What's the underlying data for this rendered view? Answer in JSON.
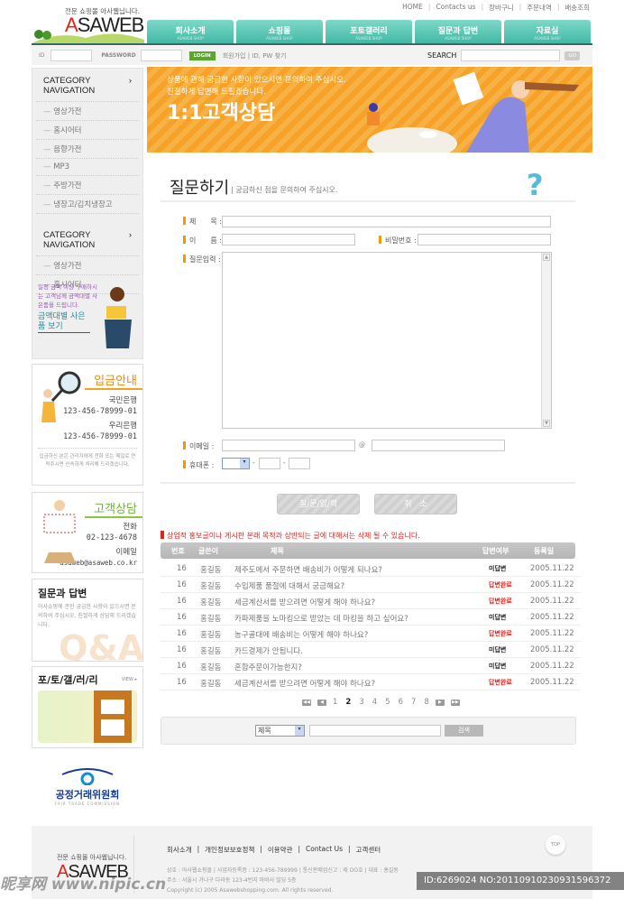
{
  "header": {
    "tagline": "전문 쇼핑몰 아사웹닙니다.",
    "logo_a": "A",
    "logo_rest": "SAWEB",
    "top_links": [
      "HOME",
      "Contacts us",
      "장바구니",
      "주문내역",
      "배송조회"
    ],
    "tabs": [
      {
        "label": "회사소개",
        "sub": "ASAWEB SHOP"
      },
      {
        "label": "쇼핑몰",
        "sub": "ASAWEB SHOP"
      },
      {
        "label": "포토갤러리",
        "sub": "ASAWEB SHOP"
      },
      {
        "label": "질문과 답변",
        "sub": "ASAWEB SHOP"
      },
      {
        "label": "자료실",
        "sub": "ASAWEB SHOP"
      }
    ],
    "accent": "#3fb8a4"
  },
  "loginbar": {
    "id_label": "ID",
    "pw_label": "PASSWORD",
    "login": "LOGIN",
    "join": "회원가입 | ID, PW 찾기",
    "search_label": "SEARCH",
    "go": "GO"
  },
  "banner": {
    "line1": "상품에 관해 궁금한 사항이 있으시면 문의하여 주십시오.",
    "line2": "친절하게 답변해 드릴겠습니다.",
    "title": "1:1고객상담"
  },
  "sidebar": {
    "cat1": {
      "title": "CATEGORY NAVIGATION",
      "items": [
        "영상가전",
        "홈시어터",
        "음향가전",
        "MP3",
        "주방가전",
        "냉장고/김치냉장고"
      ]
    },
    "cat2": {
      "title": "CATEGORY NAVIGATION",
      "items": [
        "영상가전",
        "홈시어터"
      ]
    },
    "promo": {
      "text": "일정 금액 이상 구매하시는 고객님께 금액대별 사은품을 드립니다.",
      "link": "금액대별 사은품 보기"
    },
    "deposit": {
      "title": "입금안내",
      "bank1": "국민은행",
      "acct1": "123-456-78999-01",
      "bank2": "우리은행",
      "acct2": "123-456-78999-01",
      "note": "입금하신 분은 관리자에게 전화 또는 메일로 연락주시면 신속하게 처리해 드리겠습니다."
    },
    "consult": {
      "title": "고객상담",
      "phone_label": "전화",
      "phone": "02-123-4678",
      "email_label": "이메일",
      "email": "asaweb@asaweb.co.kr"
    },
    "qna": {
      "title": "질문과 답변",
      "text": "아사쇼핑에 관한 궁금한 사항이 있으시면 문의하여 주십시오. 친절하게 상담해 드리겠습니다.",
      "deco": "Q&A"
    },
    "gallery": {
      "title": "포/토/갤/러/리",
      "view": "VIEW ▸"
    },
    "ftc": {
      "name": "공정거래위원회",
      "sub": "FAIR TRADE COMMISSION"
    }
  },
  "main": {
    "title": "질문하기",
    "subtitle": "| 궁금하신 점을 문의하여 주십시오.",
    "form": {
      "subject": "제　　목 :",
      "name": "이　　름 :",
      "password": "비밀번호 :",
      "content": "질문입력 :",
      "email": "이메일 :",
      "at": "@",
      "phone": "휴대폰 :",
      "dash": "-"
    },
    "submit": "질/문/입/력",
    "cancel": "취　소",
    "notice": "상업적 홍보글이나 게시판 본래 목적과 상반되는 글에 대해서는 삭제 될 수 있습니다.",
    "columns": [
      "번호",
      "글쓴이",
      "제목",
      "답변여부",
      "등록일"
    ],
    "rows": [
      {
        "no": "16",
        "author": "홍길동",
        "title": "제주도에서 주문하면 배송비가 어떻게 되나요?",
        "status": "미답변",
        "date": "2005.11.22"
      },
      {
        "no": "16",
        "author": "홍길동",
        "title": "수입제품 품절에 대해서 궁금해요?",
        "status": "답변완료",
        "date": "2005.11.22"
      },
      {
        "no": "16",
        "author": "홍길동",
        "title": "세금계산서를 받으려면 어떻게 해야 하나요?",
        "status": "답변완료",
        "date": "2005.11.22"
      },
      {
        "no": "16",
        "author": "홍길동",
        "title": "카파제품을 노마킹으로 받았는 데 마킹을 하고 싶어요?",
        "status": "미답변",
        "date": "2005.11.22"
      },
      {
        "no": "16",
        "author": "홍길동",
        "title": "농구골대에 배송비는 어떻게 해야 하나요?",
        "status": "답변완료",
        "date": "2005.11.22"
      },
      {
        "no": "16",
        "author": "홍길동",
        "title": "카드결제가 안됩니다.",
        "status": "미답변",
        "date": "2005.11.22"
      },
      {
        "no": "16",
        "author": "홍길동",
        "title": "혼합주문이가능한지?",
        "status": "미답변",
        "date": "2005.11.22"
      },
      {
        "no": "16",
        "author": "홍길동",
        "title": "세금계산서를 받으려면 어떻게 해야 하나요?",
        "status": "답변완료",
        "date": "2005.11.22"
      }
    ],
    "pages": [
      "1",
      "2",
      "3",
      "4",
      "5",
      "6",
      "7",
      "8"
    ],
    "current_page": "2",
    "search": {
      "select": "제목",
      "button": "검색"
    }
  },
  "footer": {
    "tagline": "전문 쇼핑몰 아사웹닙니다.",
    "links": [
      "회사소개",
      "개인정보보호정책",
      "이용약관",
      "Contact Us",
      "고객센터"
    ],
    "info1": "상호 : 아사웹쇼핑몰 | 사업자등록증 : 123-456-789999 | 통신판매업신고 : 제 OO호 | 대표 : 홍길동",
    "info2": "주소 : 서울시 가나구 다라동 123-4번지 마바사 빌딩 5층",
    "copyright": "Copyright (c) 2005 Asawebshopping.com.  All rights reserved.",
    "top": "TOP"
  },
  "watermark": {
    "left": "昵享网 www.nipic.cn",
    "right": "ID:6269024 NO:20110910230931596372"
  }
}
